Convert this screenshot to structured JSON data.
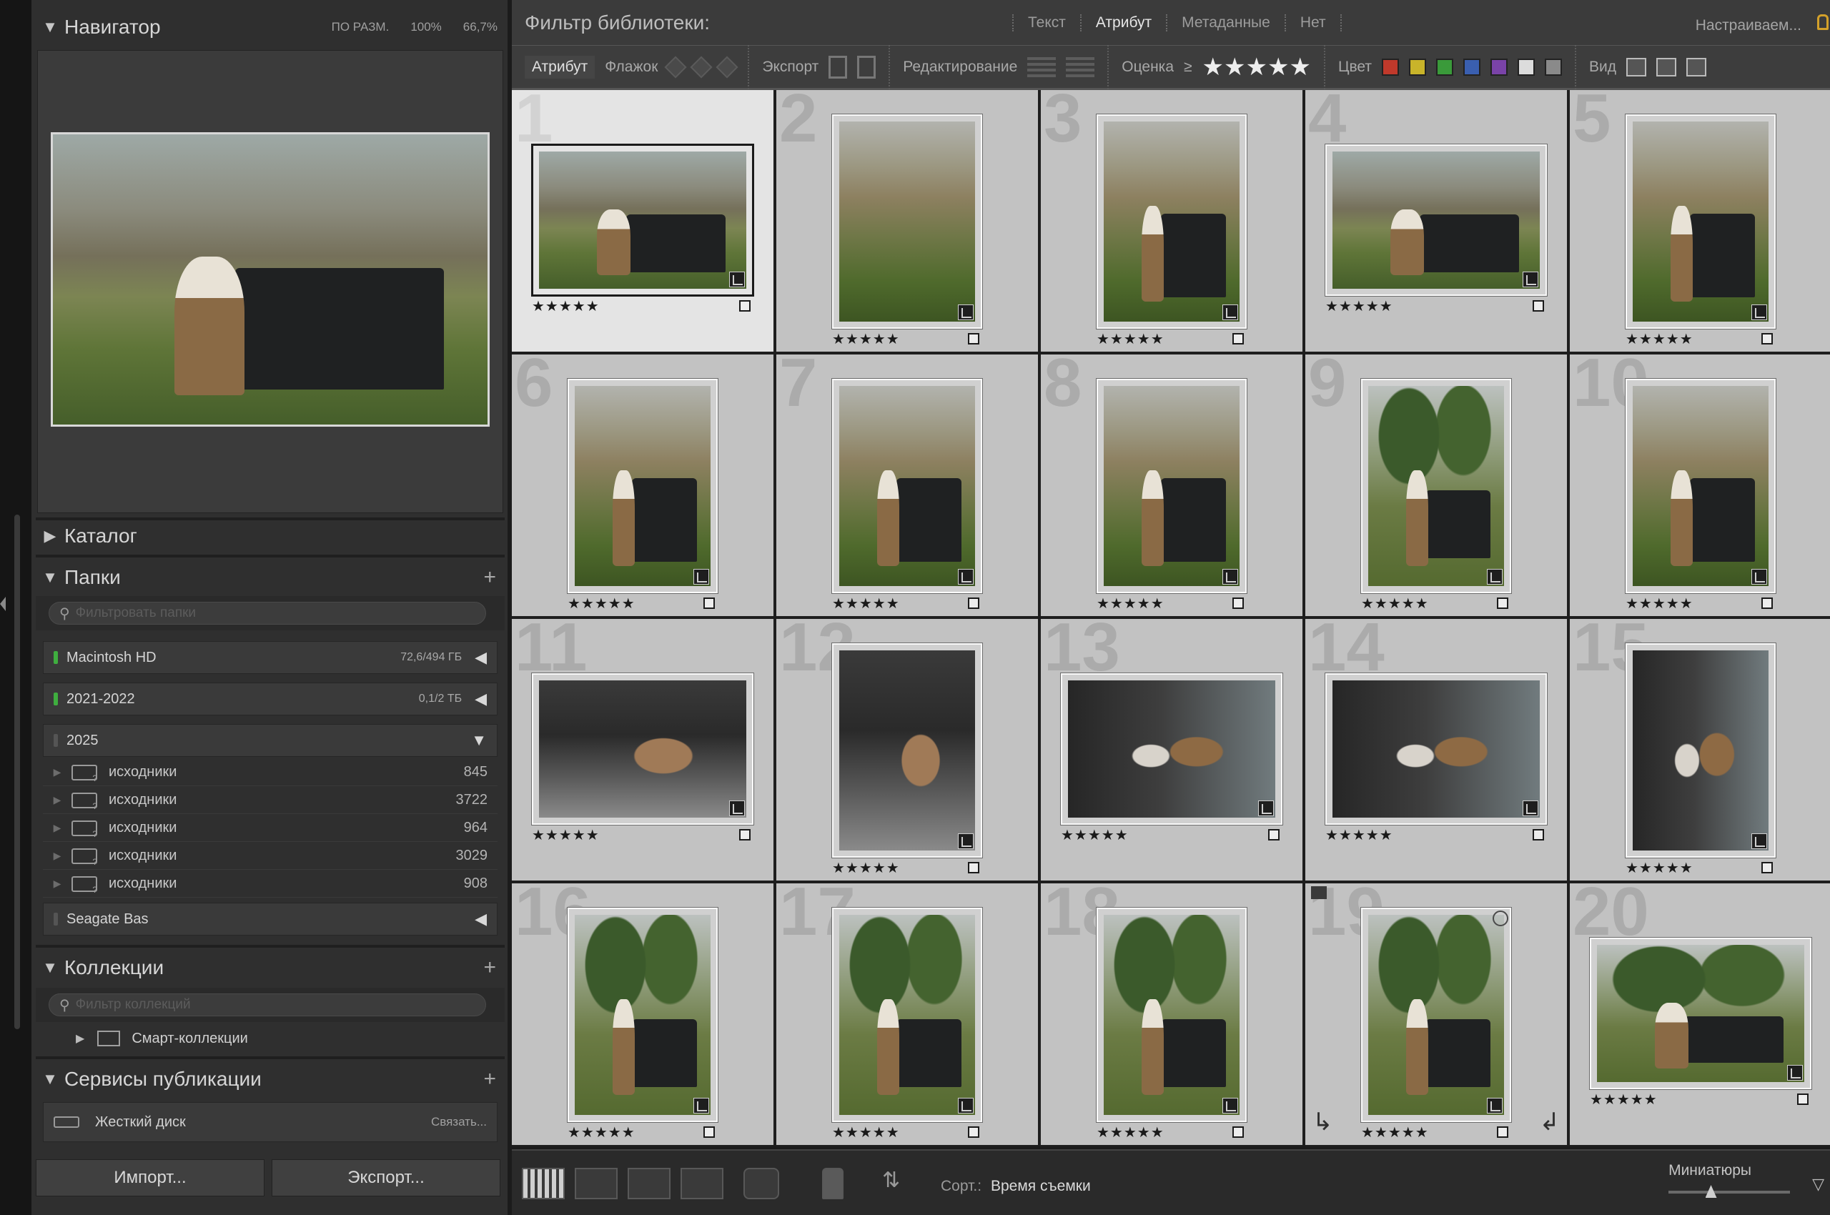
{
  "navigator": {
    "title": "Навигатор",
    "options": [
      "ПО РАЗМ.",
      "100%",
      "66,7%"
    ]
  },
  "catalog": {
    "title": "Каталог"
  },
  "folders": {
    "title": "Папки",
    "filter_placeholder": "Фильтровать папки",
    "volumes": [
      {
        "name": "Macintosh HD",
        "info": "72,6/494 ГБ",
        "led": "#3fae3f"
      },
      {
        "name": "2021-2022",
        "info": "0,1/2 ТБ",
        "led": "#3fae3f"
      },
      {
        "name": "2025",
        "info": "",
        "led": "#555555"
      }
    ],
    "subfolders": [
      {
        "name": "исходники",
        "count": "845"
      },
      {
        "name": "исходники",
        "count": "3722"
      },
      {
        "name": "исходники",
        "count": "964"
      },
      {
        "name": "исходники",
        "count": "3029"
      },
      {
        "name": "исходники",
        "count": "908"
      }
    ],
    "seagate": {
      "name": "Seagate Bas",
      "led": "#555555"
    }
  },
  "collections": {
    "title": "Коллекции",
    "filter_placeholder": "Фильтр коллекций",
    "smart": "Смарт-коллекции"
  },
  "publish": {
    "title": "Сервисы публикации",
    "service": "Жесткий диск",
    "link": "Связать..."
  },
  "buttons": {
    "import": "Импорт...",
    "export": "Экспорт..."
  },
  "filter_bar": {
    "title": "Фильтр библиотеки:",
    "tabs": [
      "Текст",
      "Атрибут",
      "Метаданные",
      "Нет"
    ],
    "active_tab": "Атрибут",
    "preset": "Настраиваем..."
  },
  "attribute_bar": {
    "attribute": "Атрибут",
    "flag": "Флажок",
    "export": "Экспорт",
    "edit": "Редактирование",
    "rating": "Оценка",
    "rating_op": "≥",
    "rating_stars": "★★★★★",
    "color": "Цвет",
    "view": "Вид",
    "swatches": [
      "#c0392b",
      "#c9b42a",
      "#3a9a3a",
      "#3a5fb0",
      "#7a43a8",
      "#dcdcdc",
      "#8a8a8a"
    ]
  },
  "grid": {
    "items": [
      {
        "n": "1",
        "stars": "★★★★★",
        "orient": "land",
        "style": "car",
        "selected": true
      },
      {
        "n": "2",
        "stars": "★★★★★",
        "orient": "port",
        "style": "portrait"
      },
      {
        "n": "3",
        "stars": "★★★★★",
        "orient": "port",
        "style": "portrait car"
      },
      {
        "n": "4",
        "stars": "★★★★★",
        "orient": "land",
        "style": "car"
      },
      {
        "n": "5",
        "stars": "★★★★★",
        "orient": "port",
        "style": "portrait car"
      },
      {
        "n": "6",
        "stars": "★★★★★",
        "orient": "port",
        "style": "portrait car"
      },
      {
        "n": "7",
        "stars": "★★★★★",
        "orient": "port",
        "style": "portrait car"
      },
      {
        "n": "8",
        "stars": "★★★★★",
        "orient": "port",
        "style": "portrait car"
      },
      {
        "n": "9",
        "stars": "★★★★★",
        "orient": "port",
        "style": "trees car"
      },
      {
        "n": "10",
        "stars": "★★★★★",
        "orient": "port",
        "style": "portrait car"
      },
      {
        "n": "11",
        "stars": "★★★★★",
        "orient": "land",
        "style": "interior"
      },
      {
        "n": "12",
        "stars": "★★★★★",
        "orient": "port",
        "style": "interior"
      },
      {
        "n": "13",
        "stars": "★★★★★",
        "orient": "land",
        "style": "interior2"
      },
      {
        "n": "14",
        "stars": "★★★★★",
        "orient": "land",
        "style": "interior2"
      },
      {
        "n": "15",
        "stars": "★★★★★",
        "orient": "port",
        "style": "interior2"
      },
      {
        "n": "16",
        "stars": "★★★★★",
        "orient": "port",
        "style": "trees car"
      },
      {
        "n": "17",
        "stars": "★★★★★",
        "orient": "port",
        "style": "trees car"
      },
      {
        "n": "18",
        "stars": "★★★★★",
        "orient": "port",
        "style": "trees car"
      },
      {
        "n": "19",
        "stars": "★★★★★",
        "orient": "port",
        "style": "trees car",
        "stack": true
      },
      {
        "n": "20",
        "stars": "★★★★★",
        "orient": "land",
        "style": "trees car"
      }
    ]
  },
  "toolbar": {
    "sort_label": "Сорт.:",
    "sort_value": "Время съемки",
    "thumbnails": "Миниатюры",
    "thumbnail_size": 0.35
  }
}
